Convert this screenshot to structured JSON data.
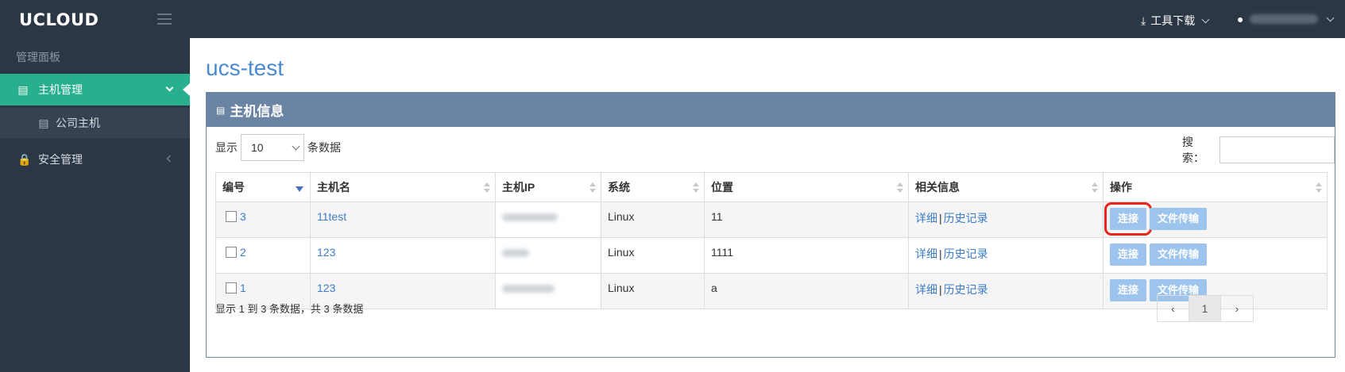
{
  "header": {
    "logo": "UCLOUD",
    "tools_label": "工具下载",
    "user_name": ""
  },
  "sidebar": {
    "heading": "管理面板",
    "items": [
      {
        "label": "主机管理",
        "icon": "server-icon"
      },
      {
        "label": "公司主机",
        "icon": "server-icon"
      },
      {
        "label": "安全管理",
        "icon": "lock-icon"
      }
    ]
  },
  "page": {
    "title": "ucs-test"
  },
  "panel": {
    "title": "主机信息",
    "show_prefix": "显示",
    "page_size": "10",
    "show_suffix": "条数据",
    "search_label": "搜索："
  },
  "table": {
    "columns": [
      "编号",
      "主机名",
      "主机IP",
      "系统",
      "位置",
      "相关信息",
      "操作"
    ],
    "rows": [
      {
        "id": "3",
        "host": "11test",
        "ip": "",
        "os": "Linux",
        "location": "11"
      },
      {
        "id": "2",
        "host": "123",
        "ip": "",
        "os": "Linux",
        "location": "1111"
      },
      {
        "id": "1",
        "host": "123",
        "ip": "",
        "os": "Linux",
        "location": "a"
      }
    ],
    "detail_label": "详细",
    "history_label": "历史记录",
    "connect_label": "连接",
    "transfer_label": "文件传输"
  },
  "footer": {
    "info": "显示 1 到 3 条数据，共 3 条数据",
    "prev": "‹",
    "page": "1",
    "next": "›"
  },
  "colors": {
    "topbar": "#2c3745",
    "active": "#28b08e",
    "panel_header": "#6b84a3",
    "button": "#9cc4ec",
    "highlight": "#e8251e"
  }
}
